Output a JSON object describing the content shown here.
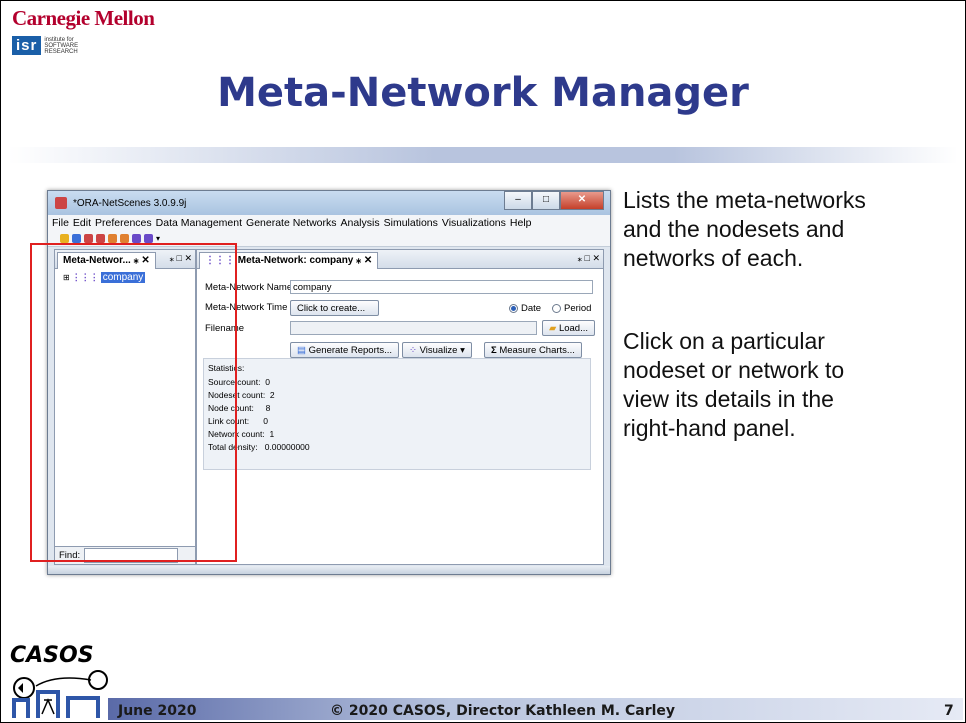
{
  "slide": {
    "cmu_logo": "Carnegie Mellon",
    "isr_logo": {
      "badge": "isr",
      "lines": [
        "institute for",
        "SOFTWARE",
        "RESEARCH"
      ]
    },
    "title": "Meta-Network Manager",
    "description_1": [
      "Lists the meta-networks",
      "and the nodesets and",
      "networks of each."
    ],
    "description_2": [
      "Click on a particular",
      "nodeset or network to",
      "view its details in the",
      "right-hand panel."
    ],
    "footer_date": "June 2020",
    "footer_copyright": "© 2020 CASOS, Director Kathleen M. Carley",
    "page_number": "7",
    "casos_logo": "CASOS"
  },
  "window": {
    "title": "*ORA-NetScenes 3.0.9.9j",
    "menu": [
      "File",
      "Edit",
      "Preferences",
      "Data Management",
      "Generate Networks",
      "Analysis",
      "Simulations",
      "Visualizations",
      "Help"
    ],
    "left_panel": {
      "tab_label": "Meta-Networ...",
      "tree_item": "company",
      "find_label": "Find:"
    },
    "right_panel": {
      "tab_label": "Meta-Network: company",
      "name_label": "Meta-Network Name",
      "name_value": "company",
      "time_label": "Meta-Network Time",
      "time_button": "Click to create...",
      "radio_date": "Date",
      "radio_period": "Period",
      "filename_label": "Filename",
      "load_button": "Load...",
      "generate_button": "Generate Reports...",
      "visualize_button": "Visualize",
      "measure_button": "Measure Charts...",
      "statistics_label": "Statistics:",
      "stats": [
        {
          "label": "Source count:",
          "value": "0"
        },
        {
          "label": "Nodeset count:",
          "value": "2"
        },
        {
          "label": "Node count:",
          "value": "8"
        },
        {
          "label": "Link count:",
          "value": "0"
        },
        {
          "label": "Network count:",
          "value": "1"
        },
        {
          "label": "Total density:",
          "value": "0.00000000"
        }
      ]
    }
  }
}
